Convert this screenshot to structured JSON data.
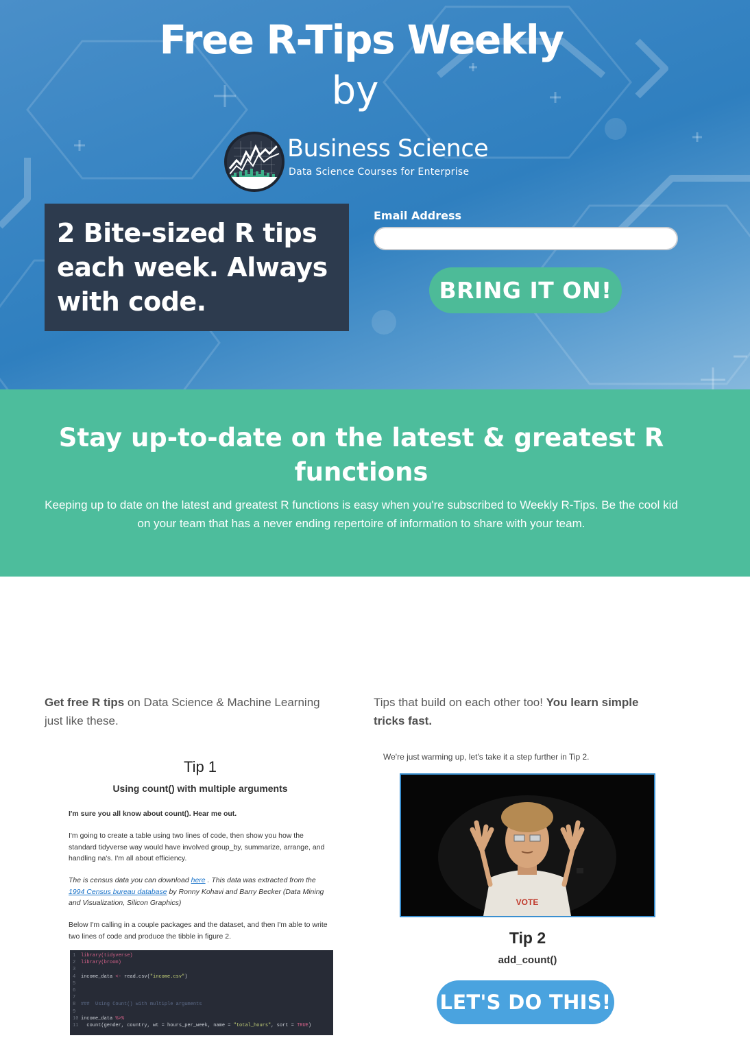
{
  "hero": {
    "title": "Free R-Tips Weekly",
    "by": "by",
    "logo_name": "Business Science",
    "logo_tagline": "Data Science Courses for Enterprise",
    "promo": "2 Bite-sized R tips each week. Always with code.",
    "email_label": "Email Address",
    "email_value": "",
    "cta_label": "BRING IT ON!"
  },
  "green": {
    "heading": "Stay up-to-date on the latest & greatest R functions",
    "body": "Keeping up to date on the latest and greatest R functions is easy when you're subscribed to Weekly R-Tips.  Be the cool kid on your team that has a never ending repertoire of information to share with your team."
  },
  "left": {
    "intro_bold": "Get free R tips",
    "intro_rest": " on Data Science & Machine Learning just like these.",
    "tip_title": "Tip 1",
    "tip_sub": "Using count() with multiple arguments",
    "p1": "I'm sure you all know about count().  Hear me out.",
    "p2": "I'm going to create a table using two lines of code, then show you how the standard tidyverse way would have involved group_by, summarize, arrange, and handling na's.  I'm all about efficiency.",
    "p3_a": "The is census data you can download ",
    "p3_link1": "here",
    "p3_b": " .  This data was extracted from the ",
    "p3_link2": "1994 Census bureau database",
    "p3_c": " by Ronny Kohavi and Barry Becker (Data Mining and Visualization, Silicon Graphics)",
    "p4": "Below I'm calling in a couple packages and the dataset, and then I'm able to write two lines of code and produce the tibble in figure 2."
  },
  "code": {
    "l1": "library(tidyverse)",
    "l2": "library(broom)",
    "l4a": "income_data ",
    "l4b": "<-",
    "l4c": " read.csv(",
    "l4d": "\"income.csv\"",
    "l4e": ")",
    "l8": "###  Using Count() with multiple arguments",
    "l10a": "income_data ",
    "l10b": "%>%",
    "l11a": "  count(gender, country, wt = hours_per_week, name = ",
    "l11b": "\"total_hours\"",
    "l11c": ", sort = ",
    "l11d": "TRUE",
    "l11e": ")"
  },
  "right": {
    "intro_plain": "Tips that build on each other too! ",
    "intro_bold": "You learn simple tricks fast.",
    "caption": "We're just warming up, let's take it a step further in Tip 2.",
    "shirt_text": "VOTE",
    "tip_title": "Tip 2",
    "tip_sub": "add_count()",
    "cta_label": "LET'S DO THIS!"
  },
  "colors": {
    "hero_blue": "#3a86c4",
    "promo_bg": "#2d3b4e",
    "green": "#4dbd9c",
    "cta_green": "#4dbb98",
    "cta_blue": "#4aa3df"
  }
}
